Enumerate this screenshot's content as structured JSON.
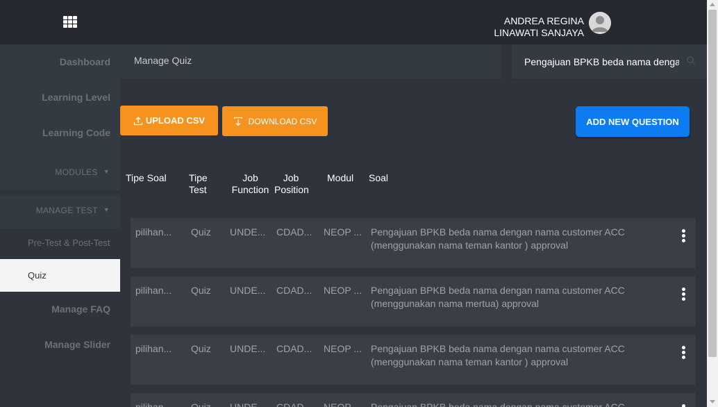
{
  "header": {
    "user_name_line1": "ANDREA REGINA",
    "user_name_line2": "LINAWATI SANJAYA",
    "menu_icon": "grid-icon",
    "avatar_icon": "user-avatar-icon"
  },
  "sidebar": {
    "items": [
      {
        "label": "Dashboard"
      },
      {
        "label": "Learning Level"
      },
      {
        "label": "Learning Code"
      }
    ],
    "modules_label": "MODULES",
    "manage_test_label": "MANAGE TEST",
    "pre_post_test_label": "Pre-Test & Post-Test",
    "quiz_label": "Quiz",
    "manage_faq_label": "Manage FAQ",
    "manage_slider_label": "Manage Slider"
  },
  "breadcrumb": {
    "title": "Manage Quiz"
  },
  "search": {
    "value": "Pengajuan BPKB beda nama dengar"
  },
  "toolbar": {
    "upload_label": "UPLOAD CSV",
    "download_label": "DOWNLOAD CSV",
    "add_label": "ADD NEW QUESTION"
  },
  "table": {
    "headers": {
      "tipe_soal": "Tipe Soal",
      "tipe_test": "Tipe Test",
      "job_function": "Job Function",
      "job_position": "Job Position",
      "modul": "Modul",
      "soal": "Soal"
    },
    "rows": [
      {
        "tipe_soal": "pilihan...",
        "tipe_test": "Quiz",
        "job_function": "UNDE...",
        "job_position": "CDAD...",
        "modul": "NEOP ...",
        "soal": "Pengajuan BPKB beda nama dengan nama customer ACC (menggunakan nama teman kantor ) approval"
      },
      {
        "tipe_soal": "pilihan...",
        "tipe_test": "Quiz",
        "job_function": "UNDE...",
        "job_position": "CDAD...",
        "modul": "NEOP ...",
        "soal": "Pengajuan BPKB beda nama dengan nama customer ACC (menggunakan nama mertua) approval"
      },
      {
        "tipe_soal": "pilihan...",
        "tipe_test": "Quiz",
        "job_function": "UNDE...",
        "job_position": "CDAD...",
        "modul": "NEOP ...",
        "soal": "Pengajuan BPKB beda nama dengan nama customer ACC (menggunakan nama teman kantor ) approval"
      },
      {
        "tipe_soal": "pilihan...",
        "tipe_test": "Quiz",
        "job_function": "UNDE...",
        "job_position": "CDAD...",
        "modul": "NEOP ...",
        "soal": "Pengajuan BPKB beda nama dengan nama customer ACC"
      }
    ]
  },
  "colors": {
    "accent_orange": "#f6921e",
    "accent_blue": "#0d7bf2",
    "background": "#2f333b"
  }
}
